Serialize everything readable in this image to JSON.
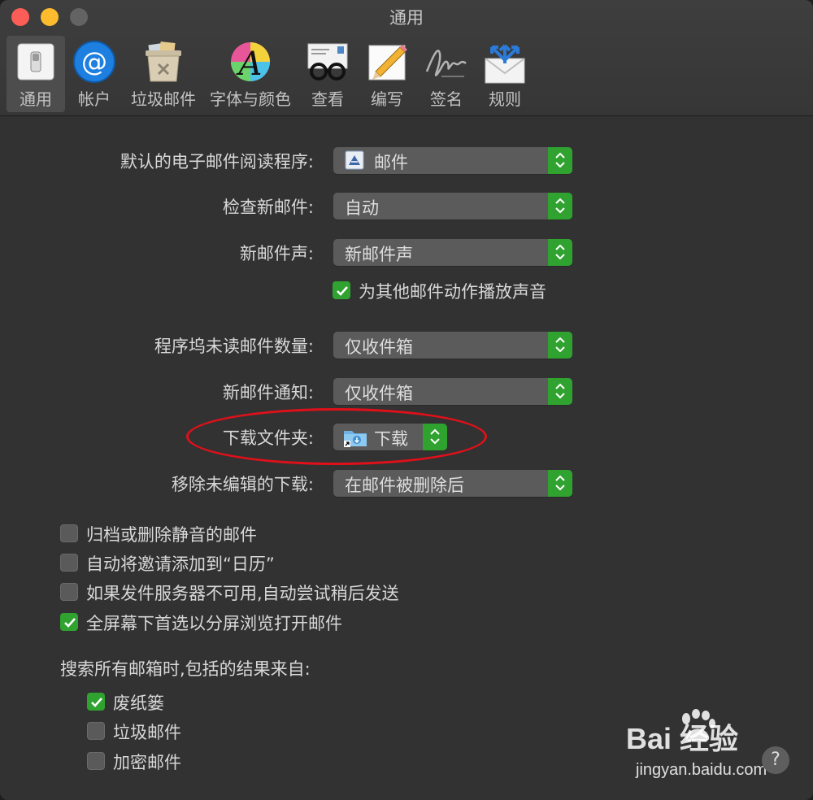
{
  "window": {
    "title": "通用"
  },
  "toolbar": [
    {
      "label": "通用",
      "icon": "general-switch-icon",
      "active": true
    },
    {
      "label": "帐户",
      "icon": "at-sign-icon"
    },
    {
      "label": "垃圾邮件",
      "icon": "junk-bin-icon"
    },
    {
      "label": "字体与颜色",
      "icon": "font-color-icon"
    },
    {
      "label": "查看",
      "icon": "glasses-envelope-icon"
    },
    {
      "label": "编写",
      "icon": "pencil-paper-icon"
    },
    {
      "label": "签名",
      "icon": "signature-icon"
    },
    {
      "label": "规则",
      "icon": "rules-envelope-icon"
    }
  ],
  "settings": {
    "default_reader": {
      "label": "默认的电子邮件阅读程序:",
      "value": "邮件"
    },
    "check_mail": {
      "label": "检查新邮件:",
      "value": "自动"
    },
    "new_mail_sound": {
      "label": "新邮件声:",
      "value": "新邮件声"
    },
    "play_sounds": {
      "label": "为其他邮件动作播放声音",
      "checked": true
    },
    "dock_unread": {
      "label": "程序坞未读邮件数量:",
      "value": "仅收件箱"
    },
    "notifications": {
      "label": "新邮件通知:",
      "value": "仅收件箱"
    },
    "downloads_folder": {
      "label": "下载文件夹:",
      "value": "下载"
    },
    "remove_downloads": {
      "label": "移除未编辑的下载:",
      "value": "在邮件被删除后"
    }
  },
  "options": [
    {
      "label": "归档或删除静音的邮件",
      "checked": false
    },
    {
      "label": "自动将邀请添加到“日历”",
      "checked": false
    },
    {
      "label": "如果发件服务器不可用,自动尝试稍后发送",
      "checked": false
    },
    {
      "label": "全屏幕下首选以分屏浏览打开邮件",
      "checked": true
    }
  ],
  "search": {
    "heading": "搜索所有邮箱时,包括的结果来自:",
    "items": [
      {
        "label": "废纸篓",
        "checked": true
      },
      {
        "label": "垃圾邮件",
        "checked": false
      },
      {
        "label": "加密邮件",
        "checked": false
      }
    ]
  },
  "help": {
    "label": "?"
  },
  "watermark": {
    "brand": "Bai 经验",
    "url": "jingyan.baidu.com"
  },
  "colors": {
    "accent": "#2fa22f",
    "highlight": "#e0101a",
    "background": "#323232"
  }
}
